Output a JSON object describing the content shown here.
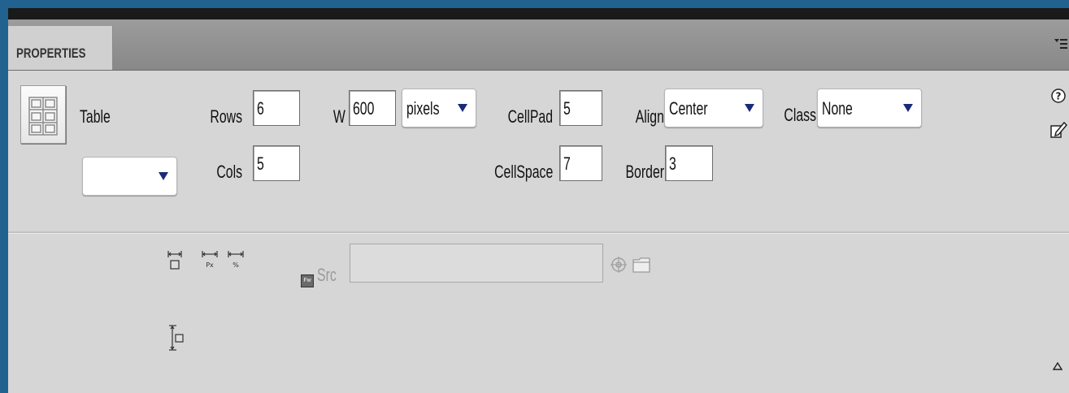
{
  "panel": {
    "tab_label": "PROPERTIES"
  },
  "table": {
    "name_label": "Table",
    "rows_label": "Rows",
    "rows_value": "6",
    "cols_label": "Cols",
    "cols_value": "5",
    "w_label": "W",
    "w_value": "600",
    "w_unit": "pixels",
    "cellpad_label": "CellPad",
    "cellpad_value": "5",
    "cellspace_label": "CellSpace",
    "cellspace_value": "7",
    "align_label": "Align",
    "align_value": "Center",
    "border_label": "Border",
    "border_value": "3",
    "class_label": "Class",
    "class_value": "None",
    "id_value": ""
  },
  "image": {
    "src_label": "Src",
    "src_value": "",
    "fw_label": "Fw"
  },
  "icons": {
    "table": "table-icon",
    "help": "help-icon",
    "quick-tag-editor": "edit-icon",
    "panel-menu": "panel-menu-icon",
    "expand": "expand-icon",
    "point-to-file": "point-to-file-icon",
    "browse": "folder-icon"
  }
}
